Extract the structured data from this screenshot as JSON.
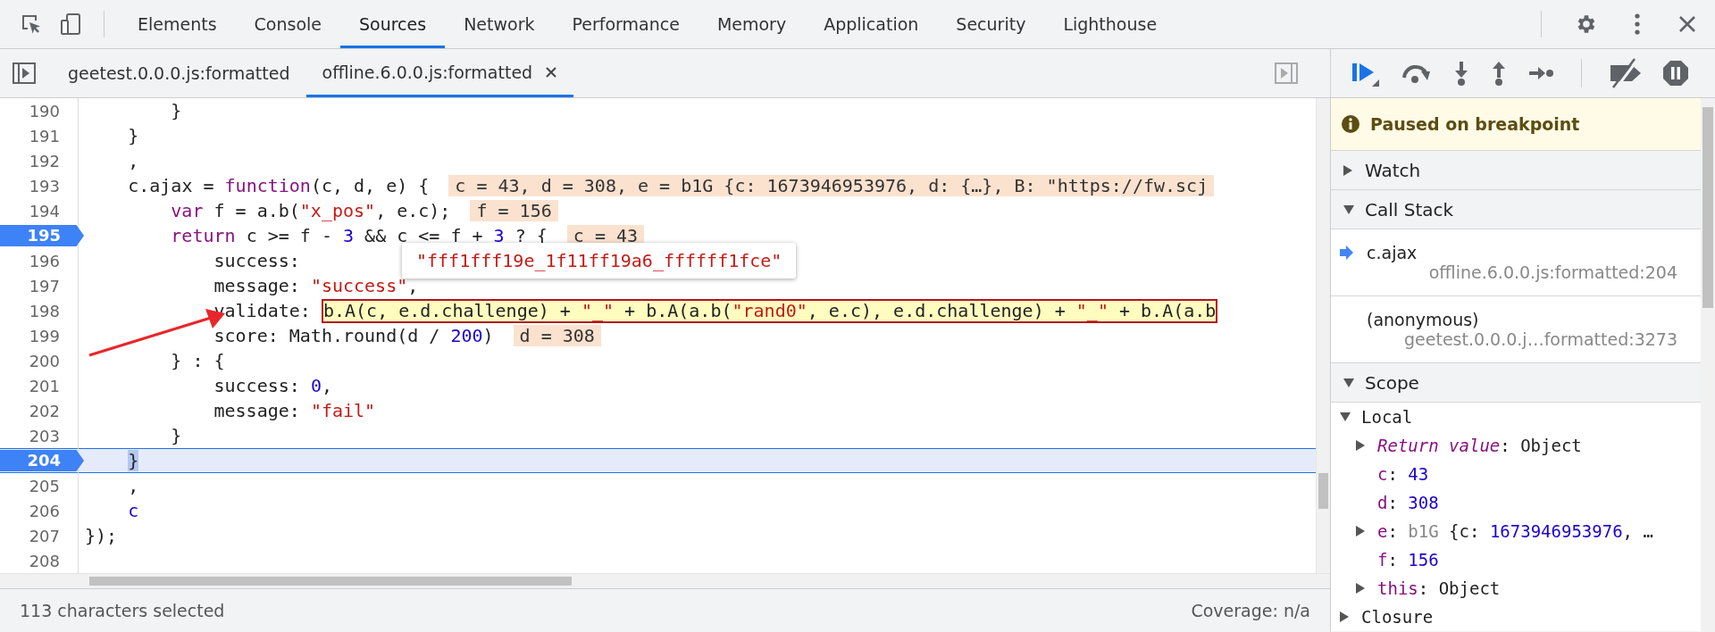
{
  "panel_tabs": [
    {
      "label": "Elements",
      "selected": false
    },
    {
      "label": "Console",
      "selected": false
    },
    {
      "label": "Sources",
      "selected": true
    },
    {
      "label": "Network",
      "selected": false
    },
    {
      "label": "Performance",
      "selected": false
    },
    {
      "label": "Memory",
      "selected": false
    },
    {
      "label": "Application",
      "selected": false
    },
    {
      "label": "Security",
      "selected": false
    },
    {
      "label": "Lighthouse",
      "selected": false
    }
  ],
  "editor_tabs": [
    {
      "label": "geetest.0.0.0.js:formatted",
      "selected": false,
      "closable": false
    },
    {
      "label": "offline.6.0.0.js:formatted",
      "selected": true,
      "closable": true
    }
  ],
  "code": {
    "lines": [
      {
        "number": "190",
        "breakpoint": false,
        "current": false,
        "tokens": [
          {
            "text": "        }",
            "kind": "plain"
          }
        ]
      },
      {
        "number": "191",
        "breakpoint": false,
        "current": false,
        "tokens": [
          {
            "text": "    }",
            "kind": "plain"
          }
        ]
      },
      {
        "number": "192",
        "breakpoint": false,
        "current": false,
        "tokens": [
          {
            "text": "    ,",
            "kind": "plain"
          }
        ]
      },
      {
        "number": "193",
        "breakpoint": false,
        "current": false,
        "tokens": [
          {
            "text": "    c.ajax = ",
            "kind": "plain"
          },
          {
            "text": "function",
            "kind": "keyword"
          },
          {
            "text": "(c, d, e) {",
            "kind": "plain"
          }
        ],
        "inline_value": "c = 43, d = 308, e = b1G {c: 1673946953976, d: {…}, B: \"https://fw.scj"
      },
      {
        "number": "194",
        "breakpoint": false,
        "current": false,
        "tokens": [
          {
            "text": "        var",
            "kind": "keyword"
          },
          {
            "text": " f = a.b(",
            "kind": "plain"
          },
          {
            "text": "\"x_pos\"",
            "kind": "string"
          },
          {
            "text": ", e.c);",
            "kind": "plain"
          }
        ],
        "inline_value": "f = 156"
      },
      {
        "number": "195",
        "breakpoint": true,
        "current": false,
        "tokens": [
          {
            "text": "        return",
            "kind": "keyword"
          },
          {
            "text": " c >= f - ",
            "kind": "plain"
          },
          {
            "text": "3",
            "kind": "number"
          },
          {
            "text": " && c <= f + ",
            "kind": "plain"
          },
          {
            "text": "3",
            "kind": "number"
          },
          {
            "text": " ? {",
            "kind": "plain"
          }
        ],
        "inline_value": "c = 43"
      },
      {
        "number": "196",
        "breakpoint": false,
        "current": false,
        "tokens": [
          {
            "text": "            success:",
            "kind": "plain"
          }
        ],
        "tooltip": "\"fff1fff19e_1f11ff19a6_ffffff1fce\""
      },
      {
        "number": "197",
        "breakpoint": false,
        "current": false,
        "tokens": [
          {
            "text": "            message: ",
            "kind": "plain"
          },
          {
            "text": "\"success\"",
            "kind": "string"
          },
          {
            "text": ",",
            "kind": "plain"
          }
        ]
      },
      {
        "number": "198",
        "breakpoint": false,
        "current": false,
        "tokens": [
          {
            "text": "            validate: ",
            "kind": "plain"
          }
        ],
        "highlight_tokens": [
          {
            "text": "b.A(c, e.d.challenge) + ",
            "kind": "plain"
          },
          {
            "text": "\"_\"",
            "kind": "string"
          },
          {
            "text": " + b.A(a.b(",
            "kind": "plain"
          },
          {
            "text": "\"rand0\"",
            "kind": "string"
          },
          {
            "text": ", e.c), e.d.challenge) + ",
            "kind": "plain"
          },
          {
            "text": "\"_\"",
            "kind": "string"
          },
          {
            "text": " + b.A(a.b",
            "kind": "plain"
          }
        ]
      },
      {
        "number": "199",
        "breakpoint": false,
        "current": false,
        "tokens": [
          {
            "text": "            score: Math.round(d / ",
            "kind": "plain"
          },
          {
            "text": "200",
            "kind": "number"
          },
          {
            "text": ")",
            "kind": "plain"
          }
        ],
        "inline_value": "d = 308"
      },
      {
        "number": "200",
        "breakpoint": false,
        "current": false,
        "tokens": [
          {
            "text": "        } : {",
            "kind": "plain"
          }
        ]
      },
      {
        "number": "201",
        "breakpoint": false,
        "current": false,
        "tokens": [
          {
            "text": "            success: ",
            "kind": "plain"
          },
          {
            "text": "0",
            "kind": "number"
          },
          {
            "text": ",",
            "kind": "plain"
          }
        ]
      },
      {
        "number": "202",
        "breakpoint": false,
        "current": false,
        "tokens": [
          {
            "text": "            message: ",
            "kind": "plain"
          },
          {
            "text": "\"fail\"",
            "kind": "string"
          }
        ]
      },
      {
        "number": "203",
        "breakpoint": false,
        "current": false,
        "tokens": [
          {
            "text": "        }",
            "kind": "plain"
          }
        ]
      },
      {
        "number": "204",
        "breakpoint": true,
        "current": true,
        "tokens": [
          {
            "text": "    }",
            "kind": "selected"
          }
        ]
      },
      {
        "number": "205",
        "breakpoint": false,
        "current": false,
        "tokens": [
          {
            "text": "    ,",
            "kind": "plain"
          }
        ]
      },
      {
        "number": "206",
        "breakpoint": false,
        "current": false,
        "tokens": [
          {
            "text": "    c",
            "kind": "name"
          }
        ]
      },
      {
        "number": "207",
        "breakpoint": false,
        "current": false,
        "tokens": [
          {
            "text": "});",
            "kind": "plain"
          }
        ]
      },
      {
        "number": "208",
        "breakpoint": false,
        "current": false
      }
    ]
  },
  "status_bar": {
    "selection": "113 characters selected",
    "coverage": "Coverage: n/a"
  },
  "debugger": {
    "banner": "Paused on breakpoint",
    "watch": {
      "title": "Watch",
      "expanded": false
    },
    "call_stack": {
      "title": "Call Stack",
      "expanded": true,
      "frames": [
        {
          "name": "c.ajax",
          "location": "offline.6.0.0.js:formatted:204",
          "selected": true
        },
        {
          "name": "(anonymous)",
          "location": "geetest.0.0.0.j…formatted:3273",
          "selected": false
        }
      ]
    },
    "scope": {
      "title": "Scope",
      "expanded": true,
      "groups": [
        {
          "name": "Local",
          "expanded": true,
          "children": [
            {
              "name": "Return value",
              "special": true,
              "expandable": true,
              "value": [
                {
                  "text": ": Object",
                  "kind": "plain"
                }
              ]
            },
            {
              "name": "c",
              "special": false,
              "expandable": false,
              "value": [
                {
                  "text": ": ",
                  "kind": "plain"
                },
                {
                  "text": "43",
                  "kind": "number"
                }
              ]
            },
            {
              "name": "d",
              "special": false,
              "expandable": false,
              "value": [
                {
                  "text": ": ",
                  "kind": "plain"
                },
                {
                  "text": "308",
                  "kind": "number"
                }
              ]
            },
            {
              "name": "e",
              "special": false,
              "expandable": true,
              "value": [
                {
                  "text": ": ",
                  "kind": "plain"
                },
                {
                  "text": "b1G",
                  "kind": "muted"
                },
                {
                  "text": " {c: ",
                  "kind": "plain"
                },
                {
                  "text": "1673946953976",
                  "kind": "number"
                },
                {
                  "text": ", …",
                  "kind": "plain"
                }
              ]
            },
            {
              "name": "f",
              "special": false,
              "expandable": false,
              "value": [
                {
                  "text": ": ",
                  "kind": "plain"
                },
                {
                  "text": "156",
                  "kind": "number"
                }
              ]
            },
            {
              "name": "this",
              "special": false,
              "expandable": true,
              "value": [
                {
                  "text": ": Object",
                  "kind": "plain"
                }
              ]
            }
          ]
        },
        {
          "name": "Closure",
          "expanded": false
        }
      ]
    }
  }
}
